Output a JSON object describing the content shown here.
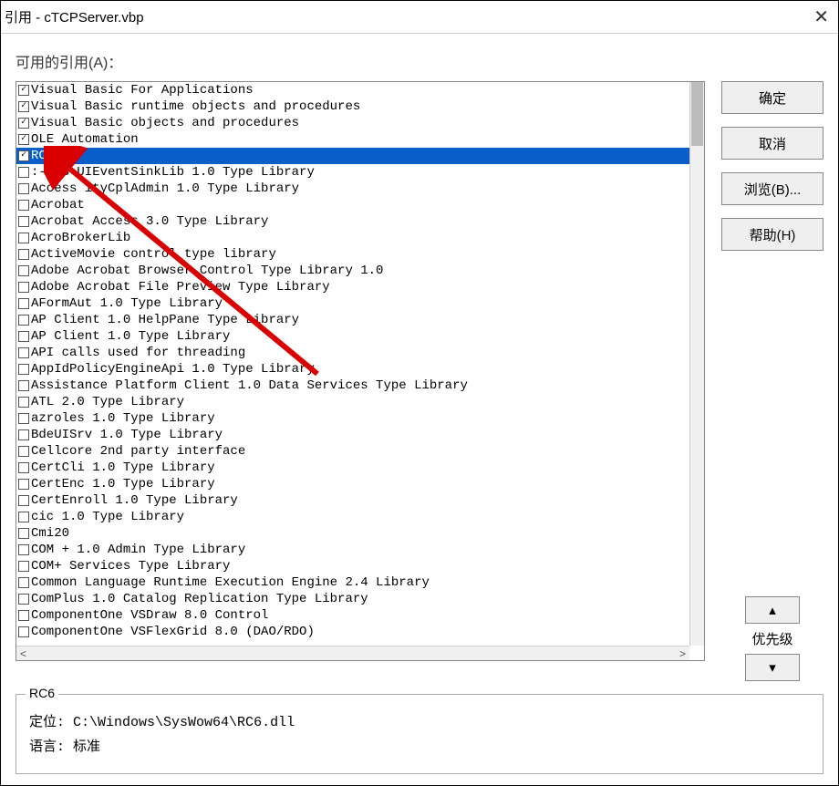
{
  "window": {
    "title": "引用 - cTCPServer.vbp"
  },
  "labels": {
    "available": "可用的引用(A)："
  },
  "buttons": {
    "ok": "确定",
    "cancel": "取消",
    "browse": "浏览(B)...",
    "help": "帮助(H)",
    "priority": "优先级"
  },
  "selectedIndex": 4,
  "references": [
    {
      "checked": true,
      "label": "Visual Basic For Applications"
    },
    {
      "checked": true,
      "label": "Visual Basic runtime objects and procedures"
    },
    {
      "checked": true,
      "label": "Visual Basic objects and procedures"
    },
    {
      "checked": true,
      "label": "OLE Automation"
    },
    {
      "checked": true,
      "label": "RC6"
    },
    {
      "checked": false,
      "label": ":-) S   UIEventSinkLib 1.0 Type Library"
    },
    {
      "checked": false,
      "label": "Access    ityCplAdmin 1.0 Type Library"
    },
    {
      "checked": false,
      "label": "Acrobat"
    },
    {
      "checked": false,
      "label": "Acrobat Access 3.0 Type Library"
    },
    {
      "checked": false,
      "label": "AcroBrokerLib"
    },
    {
      "checked": false,
      "label": "ActiveMovie control type library"
    },
    {
      "checked": false,
      "label": "Adobe Acrobat Browser Control Type Library 1.0"
    },
    {
      "checked": false,
      "label": "Adobe Acrobat File Preview Type Library"
    },
    {
      "checked": false,
      "label": "AFormAut 1.0 Type Library"
    },
    {
      "checked": false,
      "label": "AP Client 1.0 HelpPane Type Library"
    },
    {
      "checked": false,
      "label": "AP Client 1.0 Type Library"
    },
    {
      "checked": false,
      "label": "API calls used for threading"
    },
    {
      "checked": false,
      "label": "AppIdPolicyEngineApi 1.0 Type Library"
    },
    {
      "checked": false,
      "label": "Assistance Platform Client 1.0 Data Services Type Library"
    },
    {
      "checked": false,
      "label": "ATL 2.0 Type Library"
    },
    {
      "checked": false,
      "label": "azroles 1.0 Type Library"
    },
    {
      "checked": false,
      "label": "BdeUISrv 1.0 Type Library"
    },
    {
      "checked": false,
      "label": "Cellcore 2nd party interface"
    },
    {
      "checked": false,
      "label": "CertCli 1.0 Type Library"
    },
    {
      "checked": false,
      "label": "CertEnc 1.0 Type Library"
    },
    {
      "checked": false,
      "label": "CertEnroll 1.0 Type Library"
    },
    {
      "checked": false,
      "label": "cic 1.0 Type Library"
    },
    {
      "checked": false,
      "label": "Cmi20"
    },
    {
      "checked": false,
      "label": "COM + 1.0 Admin Type Library"
    },
    {
      "checked": false,
      "label": "COM+ Services Type Library"
    },
    {
      "checked": false,
      "label": "Common Language Runtime Execution Engine 2.4 Library"
    },
    {
      "checked": false,
      "label": "ComPlus 1.0 Catalog Replication Type Library"
    },
    {
      "checked": false,
      "label": "ComponentOne VSDraw 8.0 Control"
    },
    {
      "checked": false,
      "label": "ComponentOne VSFlexGrid 8.0 (DAO/RDO)"
    }
  ],
  "details": {
    "legend": "RC6",
    "locationLabel": "定位:",
    "locationValue": "C:\\Windows\\SysWow64\\RC6.dll",
    "languageLabel": "语言:",
    "languageValue": "标准"
  }
}
